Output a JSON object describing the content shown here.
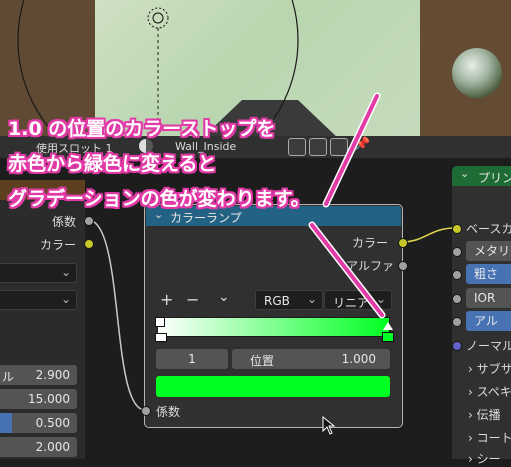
{
  "viewport_header": {
    "left_label": "使用",
    "slot_label": "スロット 1",
    "material_name": "Wall_Inside"
  },
  "left_node": {
    "socket_factor": "係数",
    "socket_color": "カラー",
    "fields": [
      {
        "label": "ル",
        "value": "2.900"
      },
      {
        "label": "",
        "value": "15.000"
      },
      {
        "label": "",
        "value": "0.500"
      },
      {
        "label": "",
        "value": "2.000"
      }
    ]
  },
  "ramp_node": {
    "title": "カラーランプ",
    "out_color": "カラー",
    "out_alpha": "アルファ",
    "in_factor": "係数",
    "add": "+",
    "remove": "−",
    "menu": "⌄",
    "color_mode": "RGB",
    "interpolation": "リニア",
    "stop_index": "1",
    "position_label": "位置",
    "position_value": "1.000",
    "gradient_from": "#ffffff",
    "gradient_to": "#00ff22",
    "active_color": "#00ff22"
  },
  "right_node": {
    "title": "プリン",
    "base_color": "ベースカ",
    "metallic": "メタリ",
    "roughness": "粗さ",
    "ior": "IOR",
    "alpha": "アル",
    "normal": "ノーマル",
    "subsurface": "サブサ",
    "specular": "スペキ",
    "transmission": "伝播",
    "coat": "コート",
    "sheen": "シー"
  },
  "annotation": {
    "line1": "1.0 の位置のカラーストップを",
    "line2": "赤色から緑色に変えると",
    "line3": "グラデーションの色が変わります。",
    "color": "#e23aa6"
  }
}
